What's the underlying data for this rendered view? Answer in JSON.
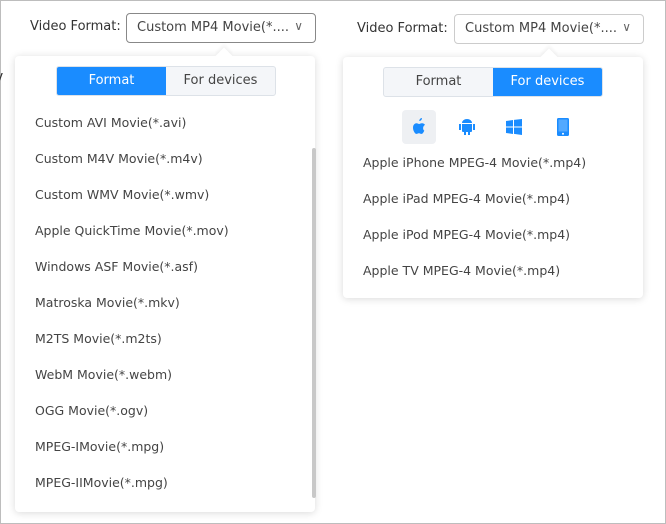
{
  "left": {
    "label": "Video Format:",
    "selected": "Custom MP4 Movie(*....",
    "tabs": [
      "Format",
      "For devices"
    ],
    "active_tab": "Format",
    "items": [
      "Custom AVI Movie(*.avi)",
      "Custom M4V Movie(*.m4v)",
      "Custom WMV Movie(*.wmv)",
      "Apple QuickTime Movie(*.mov)",
      "Windows ASF Movie(*.asf)",
      "Matroska Movie(*.mkv)",
      "M2TS Movie(*.m2ts)",
      "WebM Movie(*.webm)",
      "OGG Movie(*.ogv)",
      "MPEG-IMovie(*.mpg)",
      "MPEG-IIMovie(*.mpg)"
    ]
  },
  "right": {
    "label": "Video Format:",
    "selected": "Custom MP4 Movie(*....",
    "tabs": [
      "Format",
      "For devices"
    ],
    "active_tab": "For devices",
    "device_icons": [
      "apple-icon",
      "android-icon",
      "windows-icon",
      "phone-icon"
    ],
    "active_device": "apple-icon",
    "items": [
      "Apple iPhone MPEG-4 Movie(*.mp4)",
      "Apple iPad MPEG-4 Movie(*.mp4)",
      "Apple iPod MPEG-4 Movie(*.mp4)",
      "Apple TV MPEG-4 Movie(*.mp4)"
    ]
  },
  "accent": "#1a8cff"
}
